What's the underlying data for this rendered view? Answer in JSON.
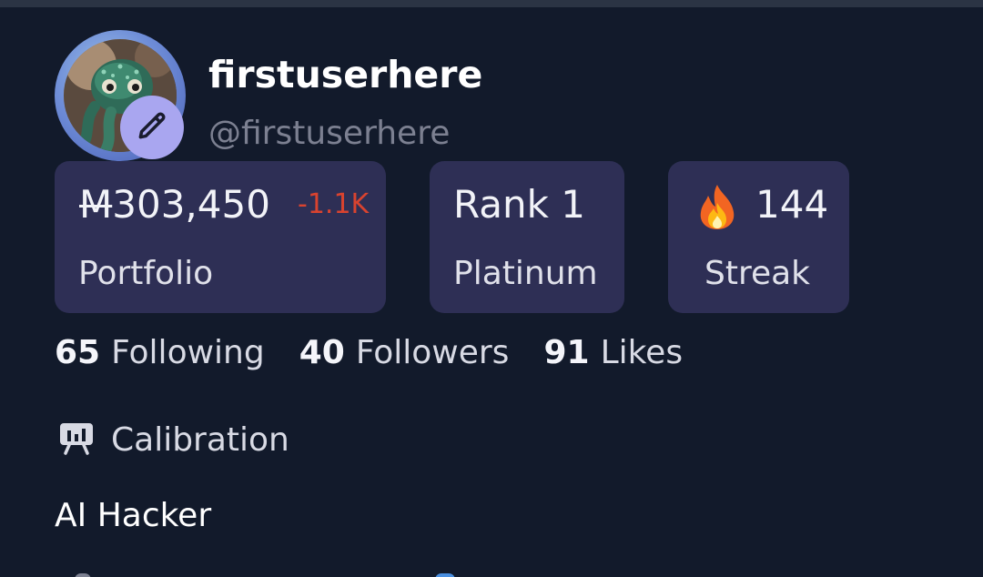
{
  "profile": {
    "display_name": "firstuserhere",
    "handle": "@firstuserhere",
    "avatar_description": "green octopus figure"
  },
  "stats": {
    "portfolio": {
      "currency_symbol": "M",
      "amount": "303,450",
      "delta": "-1.1K",
      "label": "Portfolio"
    },
    "rank": {
      "value": "Rank 1",
      "label": "Platinum"
    },
    "streak": {
      "icon": "fire-icon",
      "value": "144",
      "label": "Streak"
    }
  },
  "social": {
    "following_count": "65",
    "following_label": "Following",
    "followers_count": "40",
    "followers_label": "Followers",
    "likes_count": "91",
    "likes_label": "Likes"
  },
  "calibration": {
    "icon": "presentation-chart-icon",
    "label": "Calibration"
  },
  "bio": "AI Hacker",
  "colors": {
    "background": "#121A2B",
    "card": "#2E2F55",
    "edit_badge": "#A9A6F0",
    "negative_delta": "#D9432F",
    "muted_text": "#7C8091"
  }
}
